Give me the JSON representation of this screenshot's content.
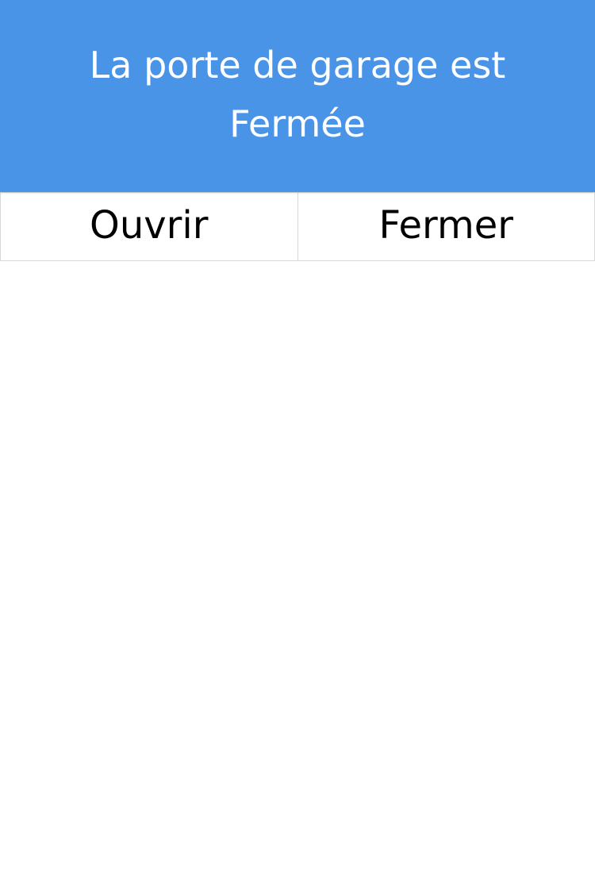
{
  "header": {
    "status_prefix": "La porte de garage est",
    "status_value": "Fermée",
    "background_color": "#4a94e8",
    "text_color": "#ffffff"
  },
  "actions": {
    "open_label": "Ouvrir",
    "close_label": "Fermer"
  }
}
